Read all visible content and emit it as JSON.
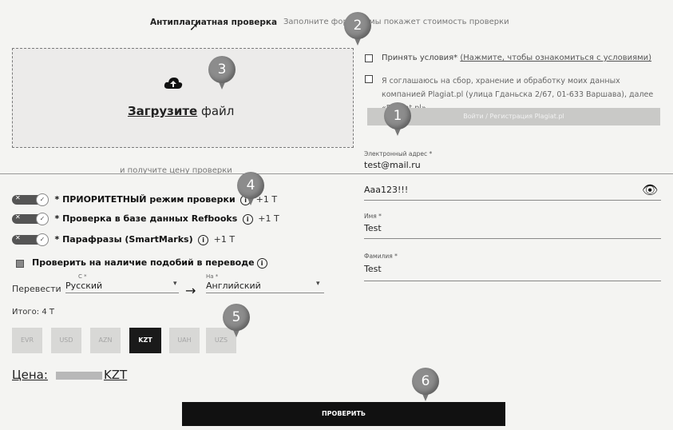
{
  "header": {
    "title": "Антиплагиатная проверка",
    "subtitle": "Заполните форму и мы покажет стоимость проверки"
  },
  "upload": {
    "link": "Загрузите",
    "text": " файл",
    "hint": "и получите цену проверки",
    "icon": "cloud-upload-icon"
  },
  "terms": {
    "accept_prefix": "Принять условия* ",
    "accept_link": "(Нажмите, чтобы ознакомиться с условиями)",
    "consent": "Я соглашаюсь на сбор, хранение и обработку моих данных компанией Plagiat.pl (улица Гданьска 2/67, 01-633 Варшава), далее «Plagiat.pl».",
    "button": "Войти / Регистрация Plagiat.pl"
  },
  "fields": {
    "email_label": "Электронный адрес *",
    "email_value": "test@mail.ru",
    "password_value": "Aaa123!!!",
    "first_name_label": "Имя *",
    "first_name_value": "Test",
    "last_name_label": "Фамилия *",
    "last_name_value": "Test"
  },
  "options": [
    {
      "label": "ПРИОРИТЕТНЫЙ режим проверки",
      "price": "+1 Т"
    },
    {
      "label": "Проверка в базе данных Refbooks",
      "price": "+1 Т"
    },
    {
      "label": "Парафразы (SmartMarks)",
      "price": "+1 Т"
    }
  ],
  "translation": {
    "checkbox_label": "Проверить на наличие подобий в переводе",
    "label": "Перевести",
    "from_label": "С *",
    "from_value": "Русский",
    "to_label": "На *",
    "to_value": "Английский"
  },
  "total": "Итого: 4 Т",
  "currencies": [
    {
      "code": "EVR",
      "active": false
    },
    {
      "code": "USD",
      "active": false
    },
    {
      "code": "AZN",
      "active": false
    },
    {
      "code": "KZT",
      "active": true
    },
    {
      "code": "UAH",
      "active": false
    },
    {
      "code": "UZS",
      "active": false
    }
  ],
  "price": {
    "label": "Цена:",
    "currency": "KZT"
  },
  "submit": "ПРОВЕРИТЬ",
  "pins": [
    "1",
    "2",
    "3",
    "4",
    "5",
    "6"
  ],
  "colors": {
    "accent": "#111111",
    "pin": "#8c8c8c",
    "disabled": "#c9c9c7"
  }
}
